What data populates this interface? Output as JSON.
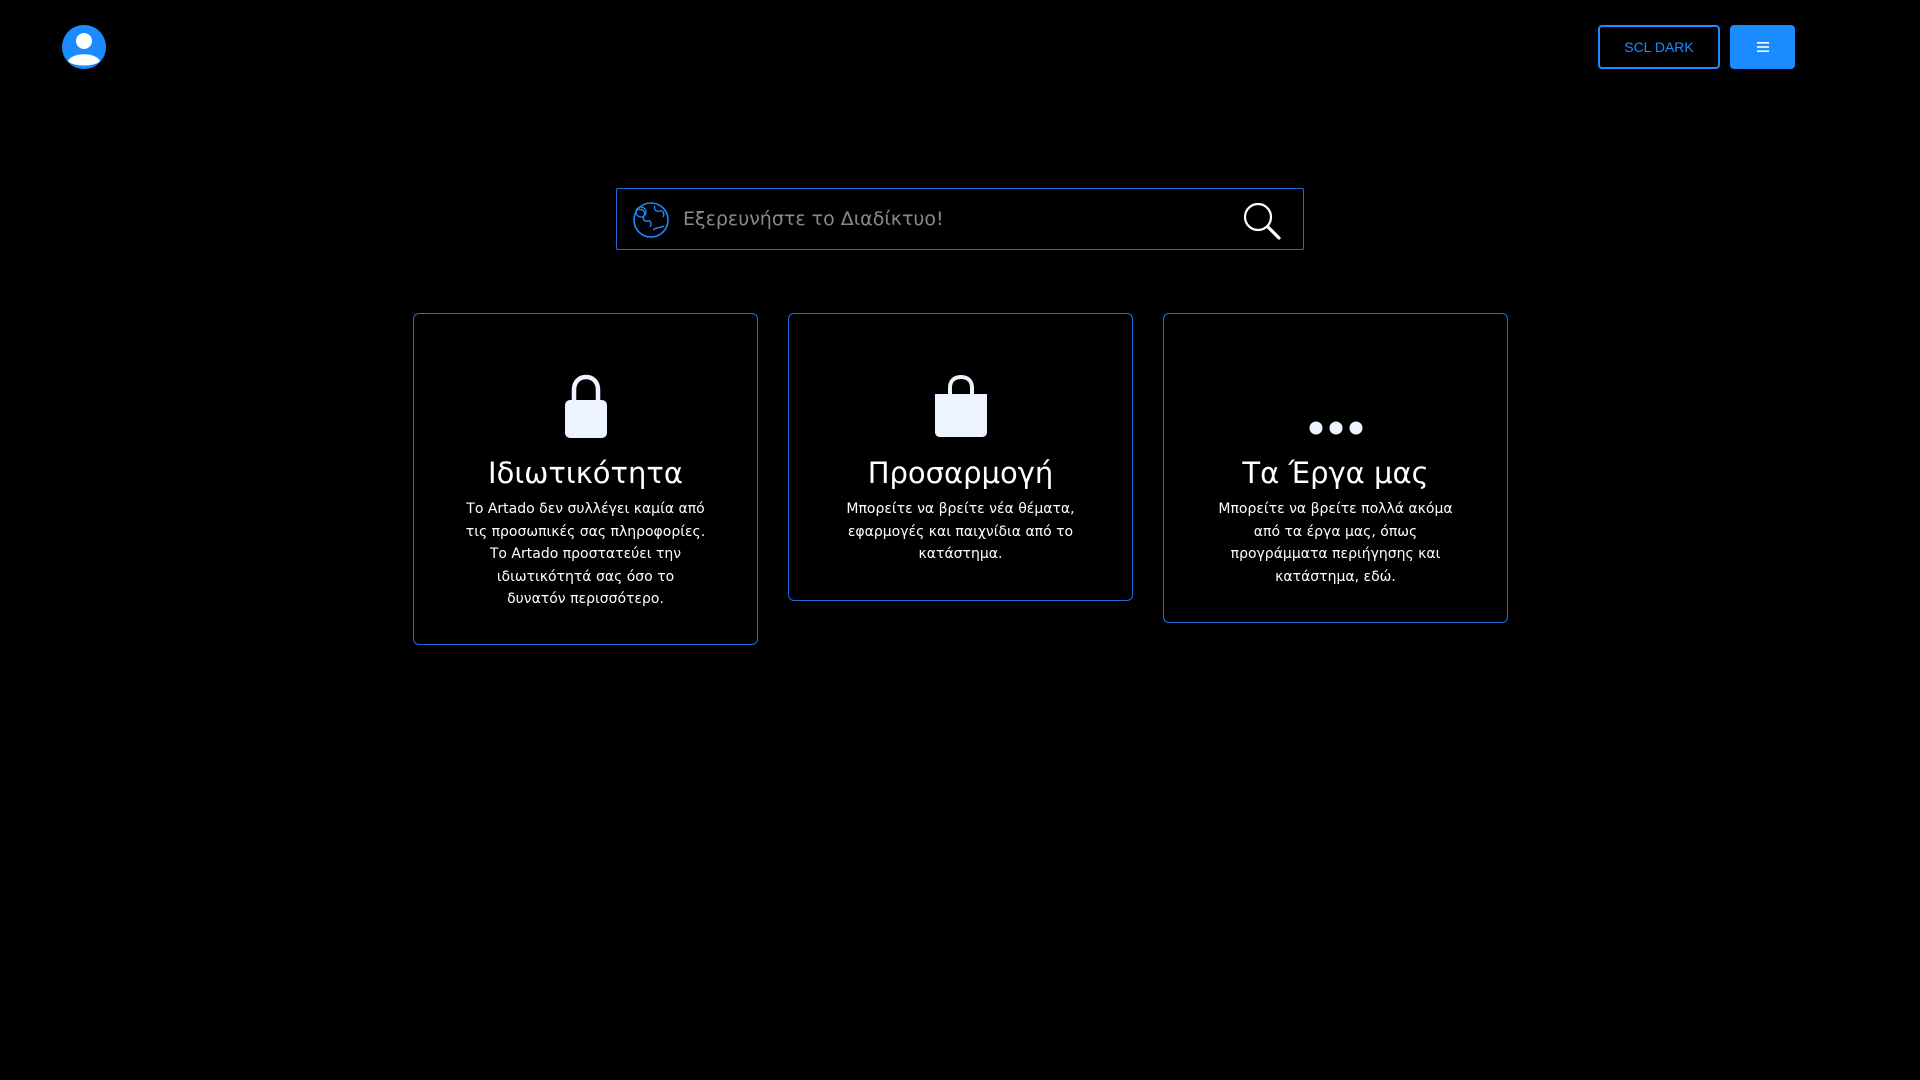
{
  "header": {
    "theme_button_label": "SCL DARK",
    "avatar_icon": "user-avatar-icon",
    "menu_icon": "hamburger-menu-icon"
  },
  "search": {
    "placeholder": "Εξερευνήστε το Διαδίκτυο!",
    "value": "",
    "left_icon": "globe-icon",
    "right_icon": "search-icon"
  },
  "cards": [
    {
      "icon": "lock-icon",
      "title": "Ιδιωτικότητα",
      "text": "Το Artado δεν συλλέγει καμία από τις προσωπικές σας πληροφορίες. Το Artado προστατεύει την ιδιωτικότητά σας όσο το δυνατόν περισσότερο."
    },
    {
      "icon": "shopping-bag-icon",
      "title": "Προσαρμογή",
      "text": "Μπορείτε να βρείτε νέα θέματα, εφαρμογές και παιχνίδια από το κατάστημα."
    },
    {
      "icon": "more-dots-icon",
      "title": "Τα Έργα μας",
      "text": "Μπορείτε να βρείτε πολλά ακόμα από τα έργα μας, όπως προγράμματα περιήγησης και κατάστημα, εδώ."
    }
  ],
  "colors": {
    "background": "#000000",
    "accent": "#1a8cff",
    "border": "#1a6fd9",
    "text": "#ffffff"
  }
}
